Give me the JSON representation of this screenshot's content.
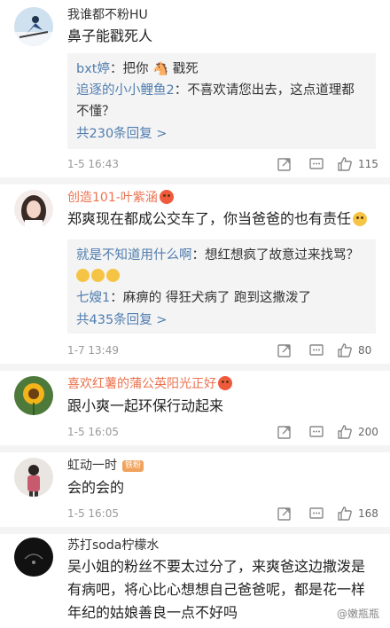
{
  "comments": [
    {
      "name": "我谁都不粉HU",
      "text": "鼻子能戳死人",
      "replies": [
        {
          "who": "bxt婷",
          "text": "：把你 🐴 戳死"
        },
        {
          "who": "追逐的小小鲤鱼2",
          "text": "：不喜欢请您出去，这点道理都不懂？"
        }
      ],
      "more": "共230条回复 >",
      "time": "1-5 16:43",
      "likes": "115"
    },
    {
      "name": "创造101-叶紫涵",
      "text": "郑爽现在都成公交车了，你当爸爸的也有责任",
      "replies": [
        {
          "who": "就是不知道用什么啊",
          "text": "：想红想疯了故意过来找骂？"
        },
        {
          "who": "七嫂1",
          "text": "：麻痹的 得狂犬病了 跑到这撒泼了"
        }
      ],
      "more": "共435条回复 >",
      "time": "1-7 13:49",
      "likes": "80"
    },
    {
      "name": "喜欢红薯的蒲公英阳光正好",
      "text": "跟小爽一起环保行动起来",
      "time": "1-5 16:05",
      "likes": "200"
    },
    {
      "name": "虹动一时",
      "badge": "铁粉",
      "text": "会的会的",
      "time": "1-5 16:05",
      "likes": "168"
    },
    {
      "name": "苏打soda柠檬水",
      "text": "吴小姐的粉丝不要太过分了，来爽爸这边撒泼是有病吧，将心比心想想自己爸爸呢，都是花一样年纪的姑娘善良一点不好吗"
    }
  ],
  "watermark": "@嫩瓶瓶"
}
